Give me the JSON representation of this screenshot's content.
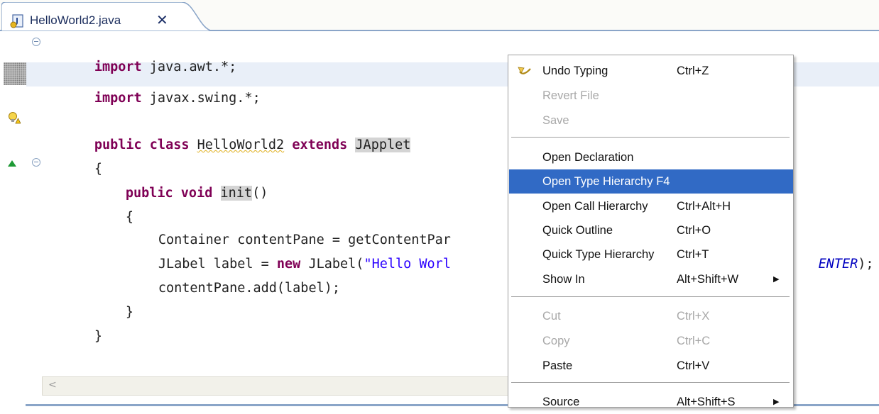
{
  "tab": {
    "title": "HelloWorld2.java",
    "close_glyph": "✕"
  },
  "code": {
    "lines": [
      {
        "parts": [
          "import",
          " java.awt.*;"
        ]
      },
      {
        "parts": [
          "import",
          " javax.swing.*;"
        ]
      },
      {
        "parts": [
          ""
        ]
      },
      {
        "parts": [
          "public",
          " ",
          "class",
          " ",
          "HelloWorld2",
          " ",
          "extends",
          " ",
          "JApplet"
        ]
      },
      {
        "parts": [
          "{"
        ]
      },
      {
        "parts": [
          "public",
          " ",
          "void",
          " ",
          "init",
          "()"
        ]
      },
      {
        "parts": [
          "{"
        ]
      },
      {
        "parts": [
          "Container contentPane = getContentPar"
        ]
      },
      {
        "parts": [
          "JLabel label = ",
          "new",
          " JLabel(",
          "\"Hello Worl",
          "ENTER",
          ");"
        ]
      },
      {
        "parts": [
          "contentPane.add(label);"
        ]
      },
      {
        "parts": [
          "}"
        ]
      },
      {
        "parts": [
          "}"
        ]
      }
    ]
  },
  "menu": {
    "items": [
      {
        "label": "Undo Typing",
        "shortcut": "Ctrl+Z",
        "icon": "undo-icon"
      },
      {
        "label": "Revert File",
        "shortcut": "",
        "disabled": true
      },
      {
        "label": "Save",
        "shortcut": "",
        "disabled": true
      },
      {
        "label": "Open Declaration",
        "shortcut": ""
      },
      {
        "label": "Open Type Hierarchy F4",
        "shortcut": "",
        "selected": true
      },
      {
        "label": "Open Call Hierarchy",
        "shortcut": "Ctrl+Alt+H"
      },
      {
        "label": "Quick Outline",
        "shortcut": "Ctrl+O"
      },
      {
        "label": "Quick Type Hierarchy",
        "shortcut": "Ctrl+T"
      },
      {
        "label": "Show In",
        "shortcut": "Alt+Shift+W",
        "submenu": true
      },
      {
        "label": "Cut",
        "shortcut": "Ctrl+X",
        "disabled": true
      },
      {
        "label": "Copy",
        "shortcut": "Ctrl+C",
        "disabled": true
      },
      {
        "label": "Paste",
        "shortcut": "Ctrl+V"
      },
      {
        "label": "Source",
        "shortcut": "Alt+Shift+S",
        "submenu": true
      }
    ],
    "submenu_glyph": "▶"
  },
  "scrollbar": {
    "left_arrow": "<"
  },
  "colors": {
    "keyword": "#7f0055",
    "string": "#2a00ff",
    "selection": "#316ac5",
    "tab_border": "#8aa5c8"
  }
}
